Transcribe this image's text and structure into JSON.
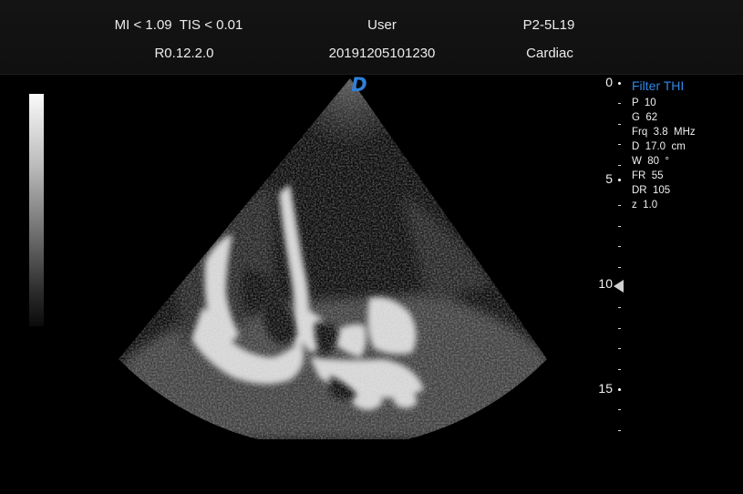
{
  "header": {
    "safety_indices": "MI < 1.09  TIS < 0.01",
    "software_version": "R0.12.2.0",
    "operator": "User",
    "exam_id": "20191205101230",
    "probe": "P2-5L19",
    "exam_mode": "Cardiac"
  },
  "logo": {
    "letter": "D",
    "color": "#2f7fd8"
  },
  "imaging_params": {
    "preset": "Filter THI",
    "preset_color": "#2f87e6",
    "items": [
      "P  10",
      "G  62",
      "Frq  3.8  MHz",
      "D  17.0  cm",
      "W  80  °",
      "FR  55",
      "DR  105",
      "z  1.0"
    ]
  },
  "depth_scale": {
    "unit": "cm",
    "max_depth": 17,
    "labels": [
      "0",
      "5",
      "10",
      "15"
    ],
    "focus_depth": 10
  },
  "colors": {
    "background": "#000000",
    "header_bg": "#121212",
    "text": "#ececec"
  }
}
